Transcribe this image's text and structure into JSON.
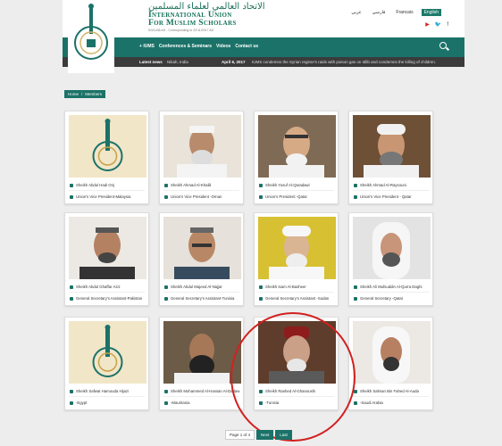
{
  "header": {
    "brand_arabic": "الاتحاد العالمي لعلماء المسلمين",
    "brand_line1": "International Union",
    "brand_line2": "For Muslim Scholars",
    "brand_date": "5/3/1438 AH - Corresponding to 22/11/2017 AD",
    "languages": [
      "عربي",
      "فارسي",
      "Francais",
      "English"
    ],
    "active_language": "English"
  },
  "nav": {
    "items": [
      "IUMS",
      "Conferences & Seminars",
      "Videos",
      "Contact us"
    ]
  },
  "news": {
    "label": "Latest news",
    "location": "Nikah, India",
    "date": "April 6, 2017",
    "headline": "IUMS condemns the Syrian regime's raids with poison gas on Idlib and condemns the killing of children."
  },
  "breadcrumb": {
    "home": "Home",
    "separator": "/",
    "current": "Members"
  },
  "members": [
    {
      "name": "Sheikh Abdul Hadi Onj",
      "role": "Union's Vice President-Malaysia"
    },
    {
      "name": "Sheikh Ahmad Al-Khalili",
      "role": "Union's Vice President -Oman"
    },
    {
      "name": "Sheikh Yusuf Al-Qaradawi",
      "role": "Union's President -Qatar"
    },
    {
      "name": "Sheikh Ahmad Al-Raysouni",
      "role": "Union's Vice President - Qatar"
    },
    {
      "name": "Sheikh Abdul Ghaffar Aziz",
      "role": "General Secretary's Assistant-Pakistan"
    },
    {
      "name": "Sheikh Abdul Majeed Al-Najjar",
      "role": "General Secretary's Assistant-Tunisia"
    },
    {
      "name": "Sheikh Isam Al-Basheer",
      "role": "General Secretary's Assistant -Sudan"
    },
    {
      "name": "Sheikh Ali Muhiuddin Al-Qurra Daghi",
      "role": "General Secretary -Qatar"
    },
    {
      "name": "Sheikh Safwat Hamouda Hijazi",
      "role": "-Egypt"
    },
    {
      "name": "Sheikh Mohammed Al-Hassan Al-Dadaw",
      "role": "-Mauritania"
    },
    {
      "name": "Sheikh Rashed Al-Ghanoushi",
      "role": "-Tunisia"
    },
    {
      "name": "Sheikh Salman Bin Fahed Al-Auda",
      "role": "-Saudi Arabia"
    }
  ],
  "pagination": {
    "page_info": "Page 1 of 4",
    "next": "Next",
    "last": "Last"
  },
  "colors": {
    "brand_green": "#1b7268",
    "highlight": "#d32020"
  }
}
